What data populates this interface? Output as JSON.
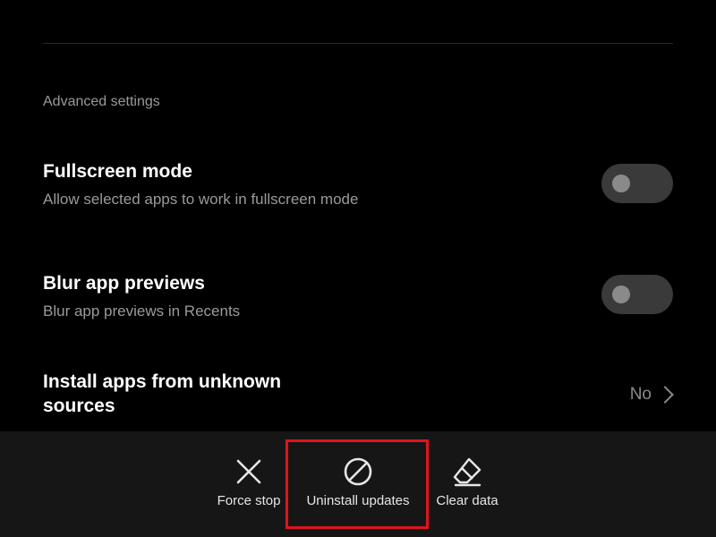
{
  "section": {
    "header": "Advanced settings"
  },
  "settings": {
    "fullscreen": {
      "title": "Fullscreen mode",
      "subtitle": "Allow selected apps to work in fullscreen mode",
      "toggle_on": false
    },
    "blur": {
      "title": "Blur app previews",
      "subtitle": "Blur app previews in Recents",
      "toggle_on": false
    },
    "unknown_sources": {
      "title_line1": "Install apps from unknown",
      "title_line2": "sources",
      "value": "No"
    }
  },
  "bottom_bar": {
    "actions": [
      {
        "label": "Force stop",
        "icon": "close-icon"
      },
      {
        "label": "Uninstall updates",
        "icon": "prohibited-icon"
      },
      {
        "label": "Clear data",
        "icon": "eraser-icon"
      }
    ],
    "highlighted_action": "Uninstall updates",
    "highlight_color": "#e0141e"
  },
  "colors": {
    "background": "#000000",
    "secondary_text": "#9a9a9a",
    "toggle_track": "#3a3a3a",
    "bottom_bar": "#161616"
  }
}
